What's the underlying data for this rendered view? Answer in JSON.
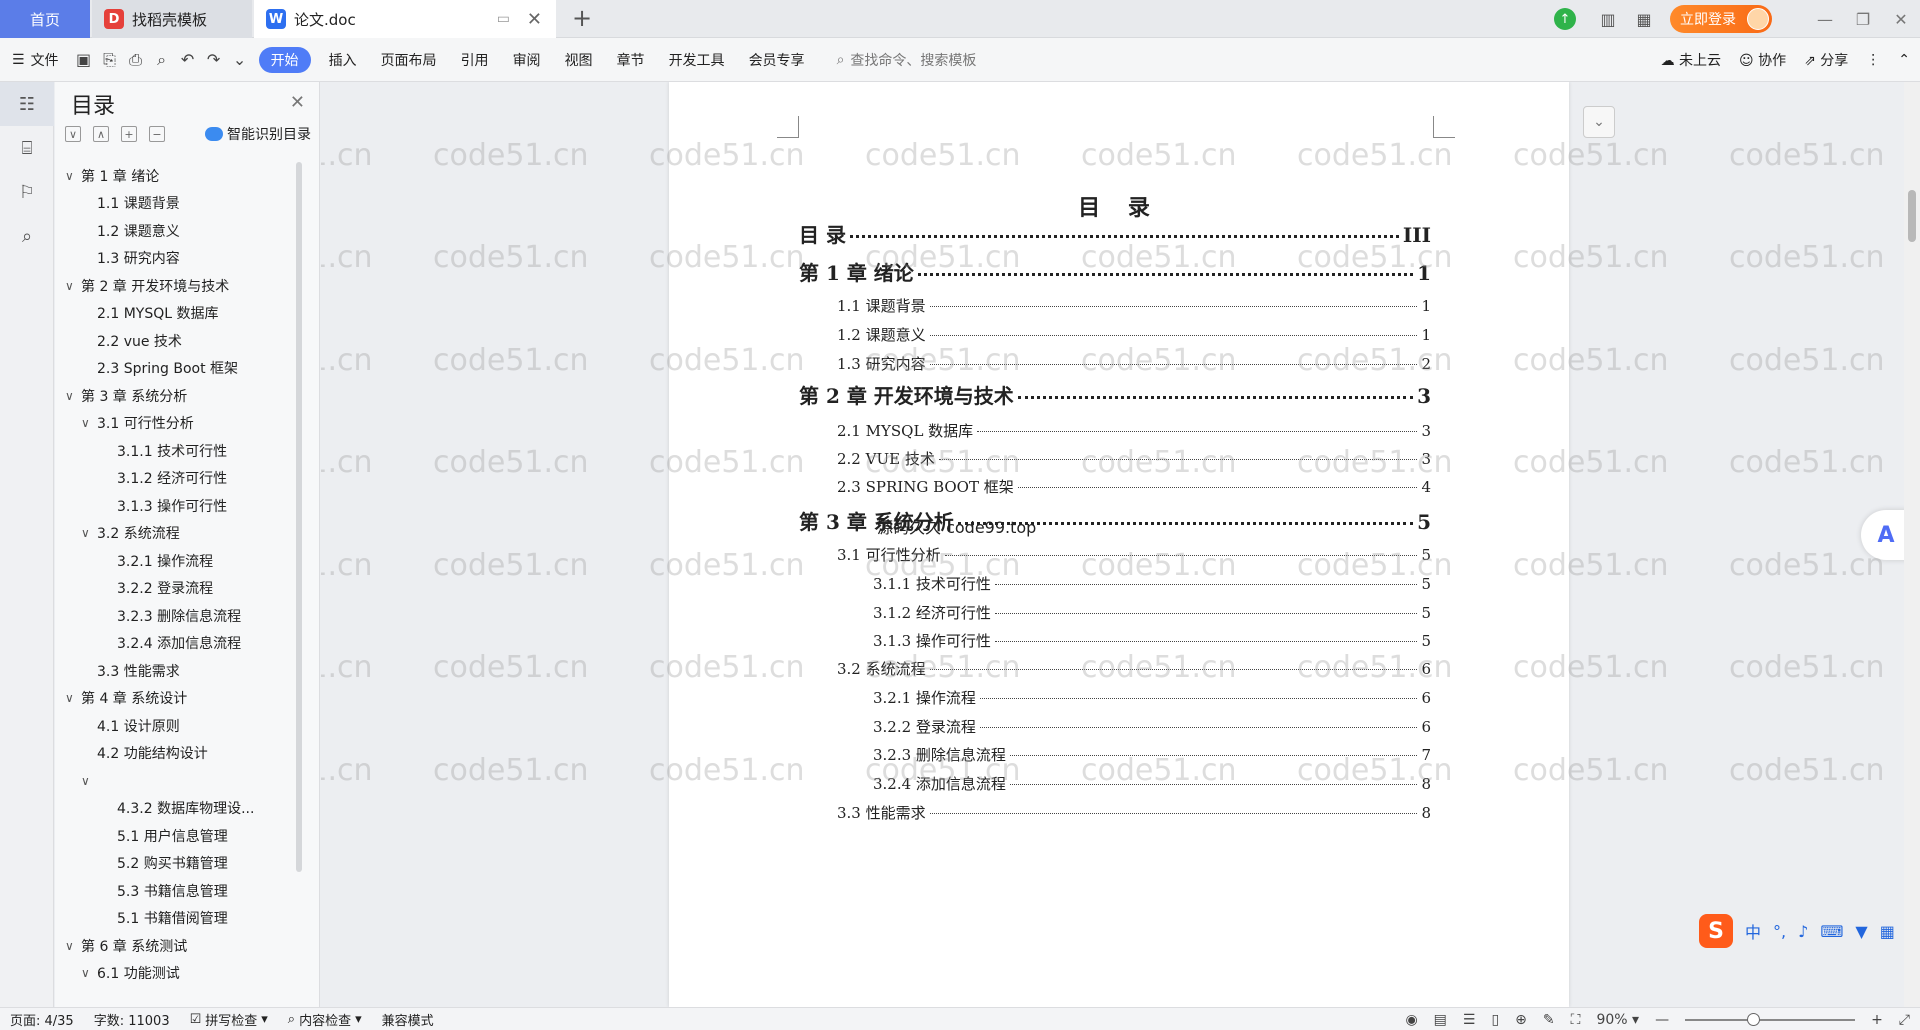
{
  "tabs": {
    "home": "首页",
    "template": "找稻壳模板",
    "document": "论文.doc"
  },
  "titlebar": {
    "login": "立即登录"
  },
  "ribbon": {
    "file": "文件",
    "items": [
      "开始",
      "插入",
      "页面布局",
      "引用",
      "审阅",
      "视图",
      "章节",
      "开发工具",
      "会员专享"
    ],
    "search": "查找命令、搜索模板",
    "cloud": "未上云",
    "collab": "协作",
    "share": "分享"
  },
  "toc": {
    "title": "目录",
    "smart": "智能识别目录",
    "items": [
      {
        "level": 1,
        "arrow": "∨",
        "text": "第 1 章  绪论"
      },
      {
        "level": 2,
        "arrow": "",
        "text": "1.1  课题背景"
      },
      {
        "level": 2,
        "arrow": "",
        "text": "1.2  课题意义"
      },
      {
        "level": 2,
        "arrow": "",
        "text": "1.3  研究内容"
      },
      {
        "level": 1,
        "arrow": "∨",
        "text": "第 2 章  开发环境与技术"
      },
      {
        "level": 2,
        "arrow": "",
        "text": "2.1  MYSQL 数据库"
      },
      {
        "level": 2,
        "arrow": "",
        "text": "2.2  vue 技术"
      },
      {
        "level": 2,
        "arrow": "",
        "text": "2.3  Spring Boot 框架"
      },
      {
        "level": 1,
        "arrow": "∨",
        "text": "第 3 章  系统分析"
      },
      {
        "level": 2,
        "arrow": "∨",
        "text": "3.1  可行性分析"
      },
      {
        "level": 3,
        "arrow": "",
        "text": "3.1.1  技术可行性"
      },
      {
        "level": 3,
        "arrow": "",
        "text": "3.1.2  经济可行性"
      },
      {
        "level": 3,
        "arrow": "",
        "text": "3.1.3  操作可行性"
      },
      {
        "level": 2,
        "arrow": "∨",
        "text": "3.2  系统流程"
      },
      {
        "level": 3,
        "arrow": "",
        "text": "3.2.1  操作流程"
      },
      {
        "level": 3,
        "arrow": "",
        "text": "3.2.2  登录流程"
      },
      {
        "level": 3,
        "arrow": "",
        "text": "3.2.3  删除信息流程"
      },
      {
        "level": 3,
        "arrow": "",
        "text": "3.2.4  添加信息流程"
      },
      {
        "level": 2,
        "arrow": "",
        "text": "3.3  性能需求"
      },
      {
        "level": 1,
        "arrow": "∨",
        "text": "第 4 章  系统设计"
      },
      {
        "level": 2,
        "arrow": "",
        "text": "4.1  设计原则"
      },
      {
        "level": 2,
        "arrow": "",
        "text": "4.2  功能结构设计"
      },
      {
        "level": 2,
        "arrow": "∨",
        "text": ""
      },
      {
        "level": 3,
        "arrow": "",
        "text": "4.3.2  数据库物理设..."
      },
      {
        "level": 3,
        "arrow": "",
        "text": "5.1 用户信息管理"
      },
      {
        "level": 3,
        "arrow": "",
        "text": "5.2  购买书籍管理"
      },
      {
        "level": 3,
        "arrow": "",
        "text": "5.3 书籍信息管理"
      },
      {
        "level": 3,
        "arrow": "",
        "text": "5.1 书籍借阅管理"
      },
      {
        "level": 1,
        "arrow": "∨",
        "text": "第 6 章  系统测试"
      },
      {
        "level": 2,
        "arrow": "∨",
        "text": "6.1  功能测试"
      }
    ]
  },
  "document": {
    "heading": "目  录",
    "entries": [
      {
        "level": 1,
        "label": "目  录",
        "page": "III"
      },
      {
        "level": 1,
        "label": "第 1 章  绪论",
        "page": "1"
      },
      {
        "level": 2,
        "label": "1.1  课题背景",
        "page": "1"
      },
      {
        "level": 2,
        "label": "1.2  课题意义",
        "page": "1"
      },
      {
        "level": 2,
        "label": "1.3  研究内容",
        "page": "2"
      },
      {
        "level": 1,
        "label": "第 2 章  开发环境与技术",
        "page": "3"
      },
      {
        "level": 2,
        "label": "2.1 MYSQL 数据库",
        "page": "3"
      },
      {
        "level": 2,
        "label": "2.2 VUE 技术",
        "page": "3"
      },
      {
        "level": 2,
        "label": "2.3 SPRING BOOT 框架",
        "page": "4"
      },
      {
        "level": 1,
        "label": "第 3 章  系统分析",
        "page": "5"
      },
      {
        "level": 2,
        "label": "3.1  可行性分析",
        "page": "5"
      },
      {
        "level": 3,
        "label": "3.1.1   技术可行性",
        "page": "5"
      },
      {
        "level": 3,
        "label": "3.1.2   经济可行性",
        "page": "5"
      },
      {
        "level": 3,
        "label": "3.1.3   操作可行性",
        "page": "5"
      },
      {
        "level": 2,
        "label": "3.2  系统流程",
        "page": "6"
      },
      {
        "level": 3,
        "label": "3.2.1   操作流程",
        "page": "6"
      },
      {
        "level": 3,
        "label": "3.2.2   登录流程",
        "page": "6"
      },
      {
        "level": 3,
        "label": "3.2.3   删除信息流程",
        "page": "7"
      },
      {
        "level": 3,
        "label": "3.2.4   添加信息流程",
        "page": "8"
      },
      {
        "level": 2,
        "label": "3.3  性能需求",
        "page": "8"
      }
    ],
    "overlay_text": "源码久久 code99.top"
  },
  "watermark": "code51.cn",
  "ime": {
    "lang": "中"
  },
  "statusbar": {
    "page": "页面: 4/35",
    "words": "字数: 11003",
    "spell": "拼写检查",
    "content_check": "内容检查",
    "compat": "兼容模式",
    "zoom": "90%",
    "zoom_fraction": 0.4
  },
  "colors": {
    "accent": "#4f7cf7",
    "home_tab": "#5b7de8",
    "login": "#f96a16"
  }
}
